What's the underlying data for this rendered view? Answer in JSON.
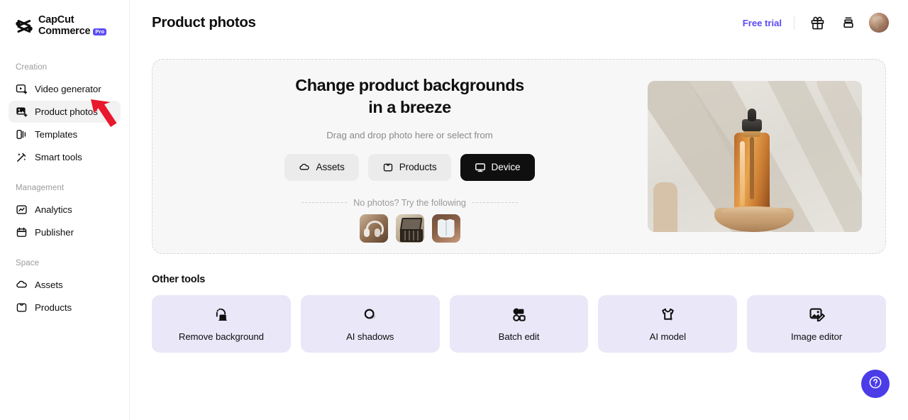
{
  "brand": {
    "line1": "CapCut",
    "line2": "Commerce",
    "badge": "Pro",
    "logo_icon": "capcut-logo-icon"
  },
  "sidebar": {
    "groups": [
      {
        "label": "Creation",
        "items": [
          {
            "label": "Video generator",
            "icon": "video-generator-icon",
            "active": false
          },
          {
            "label": "Product photos",
            "icon": "product-photos-icon",
            "active": true
          },
          {
            "label": "Templates",
            "icon": "templates-icon",
            "active": false
          },
          {
            "label": "Smart tools",
            "icon": "smart-tools-icon",
            "active": false
          }
        ]
      },
      {
        "label": "Management",
        "items": [
          {
            "label": "Analytics",
            "icon": "analytics-icon",
            "active": false
          },
          {
            "label": "Publisher",
            "icon": "publisher-icon",
            "active": false
          }
        ]
      },
      {
        "label": "Space",
        "items": [
          {
            "label": "Assets",
            "icon": "cloud-assets-icon",
            "active": false
          },
          {
            "label": "Products",
            "icon": "products-bag-icon",
            "active": false
          }
        ]
      }
    ]
  },
  "topbar": {
    "title": "Product photos",
    "free_trial": "Free trial",
    "gift_icon": "gift-icon",
    "inbox_icon": "inbox-icon",
    "avatar_icon": "user-avatar"
  },
  "hero": {
    "heading": "Change product backgrounds in a breeze",
    "subtitle": "Drag and drop photo here or select from",
    "sources": [
      {
        "label": "Assets",
        "icon": "cloud-icon",
        "primary": false
      },
      {
        "label": "Products",
        "icon": "bag-icon",
        "primary": false
      },
      {
        "label": "Device",
        "icon": "monitor-icon",
        "primary": true
      }
    ],
    "try_label": "No photos? Try the following",
    "samples": [
      {
        "name": "headphones-sample",
        "cls": "th-headphones"
      },
      {
        "name": "makeup-palette-sample",
        "cls": "th-palette"
      },
      {
        "name": "white-shirt-sample",
        "cls": "th-shirt"
      }
    ],
    "preview_image": "amber-dropper-bottle-photo"
  },
  "tools": {
    "title": "Other tools",
    "items": [
      {
        "label": "Remove background",
        "icon": "remove-background-icon"
      },
      {
        "label": "AI shadows",
        "icon": "ai-shadows-icon"
      },
      {
        "label": "Batch edit",
        "icon": "batch-edit-icon"
      },
      {
        "label": "AI model",
        "icon": "ai-model-icon"
      },
      {
        "label": "Image editor",
        "icon": "image-editor-icon"
      }
    ]
  },
  "fab": {
    "icon": "help-question-icon",
    "label": "Help"
  },
  "annotation": {
    "arrow": "red-pointer-arrow",
    "target": "Product photos"
  },
  "colors": {
    "accent_purple": "#5b4bf5",
    "fab_purple": "#4b3ce8",
    "tool_card_bg": "#eae7f9",
    "primary_black": "#0f0f0f",
    "annotation_red": "#e8192c",
    "hero_bg": "#f7f7f7"
  }
}
